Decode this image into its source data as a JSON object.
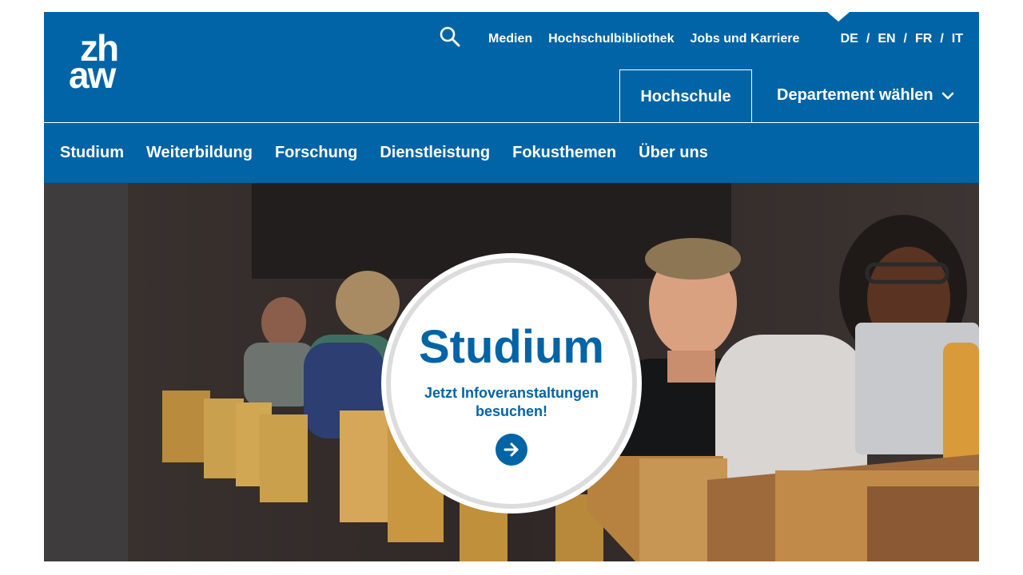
{
  "logo": {
    "line1": "zh",
    "line2": "aw"
  },
  "meta_nav": [
    "Medien",
    "Hochschulbibliothek",
    "Jobs und Karriere"
  ],
  "languages": [
    "DE",
    "EN",
    "FR",
    "IT"
  ],
  "lang_separator": "/",
  "tabs": {
    "active": "Hochschule",
    "department": "Departement wählen"
  },
  "main_nav": [
    "Studium",
    "Weiterbildung",
    "Forschung",
    "Dienstleistung",
    "Fokusthemen",
    "Über uns"
  ],
  "hero": {
    "teaser_title": "Studium",
    "teaser_text": "Jetzt Infoveranstaltungen besuchen!"
  },
  "colors": {
    "brand_blue": "#0064a6",
    "white": "#ffffff"
  },
  "icons": {
    "search": "search-icon",
    "chevron": "chevron-down-icon",
    "arrow": "arrow-right-icon"
  }
}
